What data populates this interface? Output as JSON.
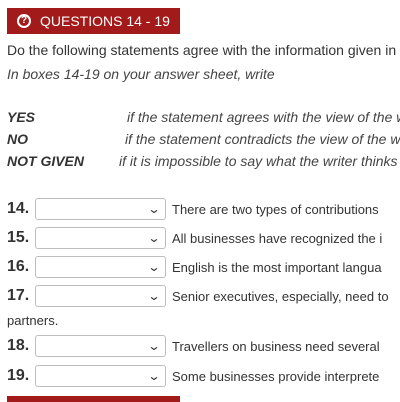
{
  "header": {
    "title": "QUESTIONS 14 - 19",
    "icon": "question-circle-icon",
    "color": "#a31a1a"
  },
  "instructions": {
    "line1": "Do the following statements agree with the information given in",
    "line2": "In boxes 14-19 on your answer sheet, write"
  },
  "key": [
    {
      "label": "YES",
      "desc": "if the statement agrees with the view of the w"
    },
    {
      "label": "NO",
      "desc": "if the statement contradicts the view of the w"
    },
    {
      "label": "NOT GIVEN",
      "desc": "if it is impossible to say what the writer thinks"
    }
  ],
  "questions": [
    {
      "num": "14.",
      "selected": "",
      "text": "There are two types of contributions"
    },
    {
      "num": "15.",
      "selected": "",
      "text": "All businesses have recognized the i"
    },
    {
      "num": "16.",
      "selected": "",
      "text": "English is the most important langua"
    },
    {
      "num": "17.",
      "selected": "",
      "text": "Senior executives, especially, need to",
      "text_cont": "partners."
    },
    {
      "num": "18.",
      "selected": "",
      "text": "Travellers on business need several"
    },
    {
      "num": "19.",
      "selected": "",
      "text": "Some businesses provide interprete"
    }
  ]
}
